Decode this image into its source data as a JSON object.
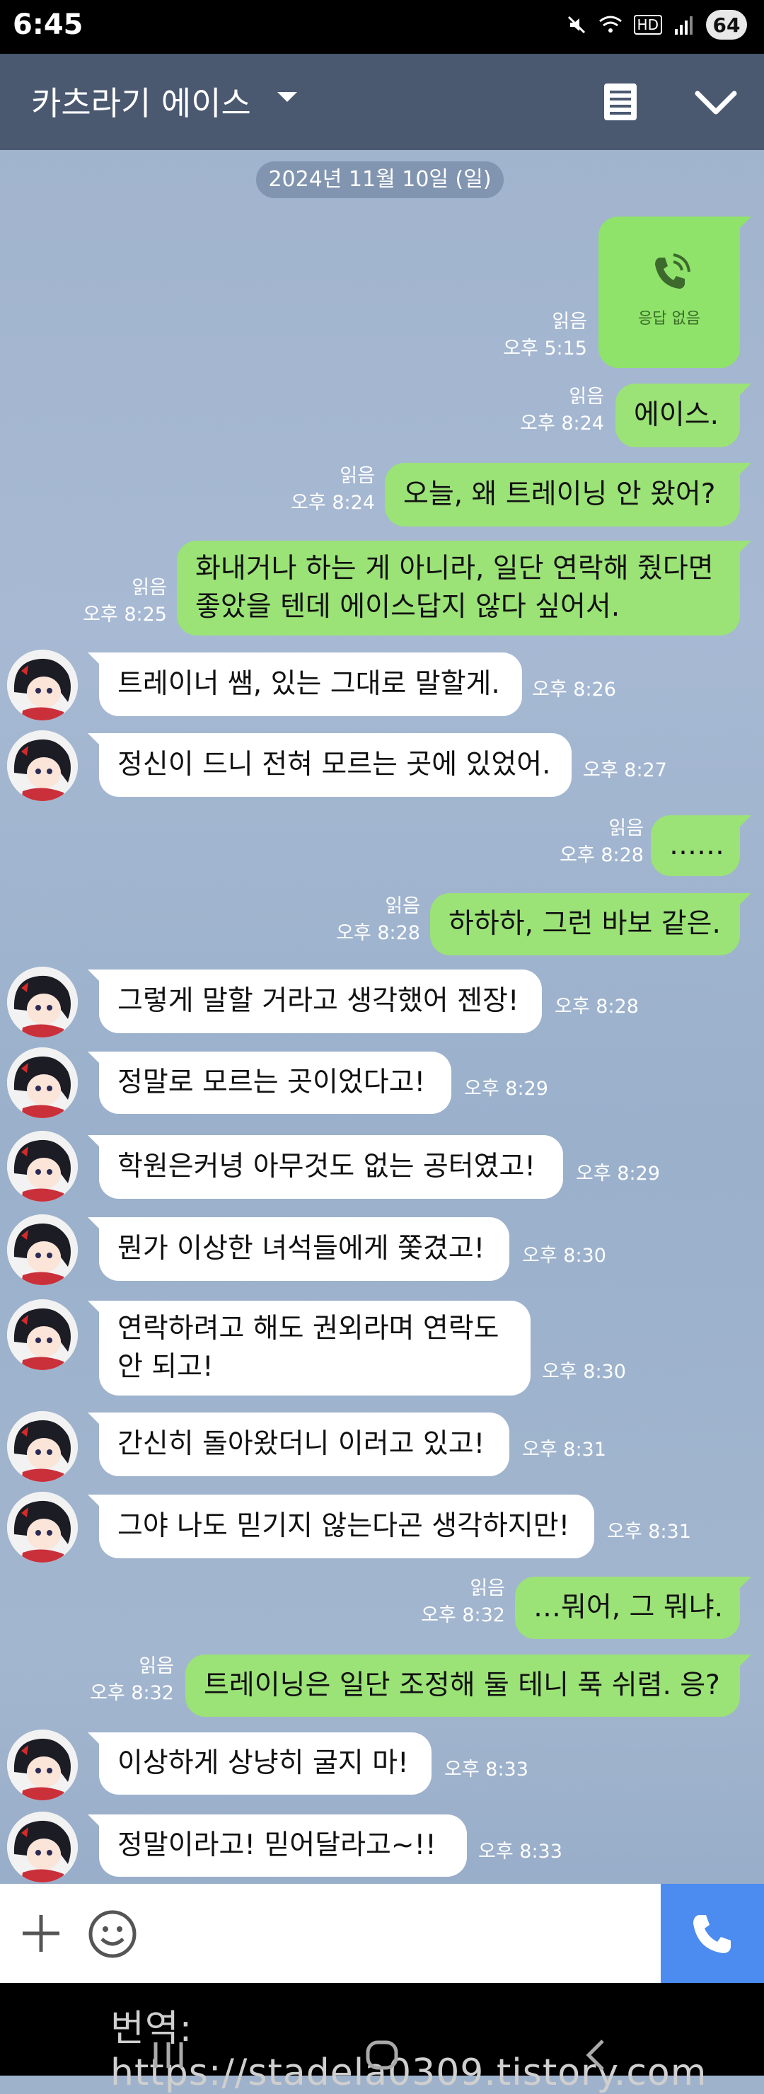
{
  "status_bar": {
    "time": "6:45",
    "battery": "64",
    "network": "HD"
  },
  "header": {
    "title": "카츠라기 에이스"
  },
  "date_divider": "2024년 11월 10일 (일)",
  "call": {
    "label": "응답 없음",
    "read": "읽음",
    "time": "오후 5:15"
  },
  "mine": [
    {
      "text": "에이스.",
      "read": "읽음",
      "time": "오후 8:24"
    },
    {
      "text": "오늘, 왜 트레이닝 안 왔어?",
      "read": "읽음",
      "time": "오후 8:24"
    },
    {
      "text": "화내거나 하는 게 아니라, 일단 연락해 줬다면 좋았을 텐데 에이스답지 않다 싶어서.",
      "read": "읽음",
      "time": "오후 8:25"
    },
    {
      "text": "……",
      "read": "읽음",
      "time": "오후 8:28"
    },
    {
      "text": "하하하, 그런 바보 같은.",
      "read": "읽음",
      "time": "오후 8:28"
    },
    {
      "text": "…뭐어, 그 뭐냐.",
      "read": "읽음",
      "time": "오후 8:32"
    },
    {
      "text": "트레이닝은 일단 조정해 둘 테니 푹 쉬렴. 응?",
      "read": "읽음",
      "time": "오후 8:32"
    }
  ],
  "theirs": [
    {
      "text": "트레이너 쌤, 있는 그대로 말할게.",
      "time": "오후 8:26"
    },
    {
      "text": "정신이 드니 전혀 모르는 곳에 있었어.",
      "time": "오후 8:27"
    },
    {
      "text": "그렇게 말할 거라고 생각했어 젠장!",
      "time": "오후 8:28"
    },
    {
      "text": "정말로 모르는 곳이었다고!",
      "time": "오후 8:29"
    },
    {
      "text": "학원은커녕 아무것도 없는 공터였고!",
      "time": "오후 8:29"
    },
    {
      "text": "뭔가 이상한 녀석들에게 쫓겼고!",
      "time": "오후 8:30"
    },
    {
      "text": "연락하려고 해도 권외라며 연락도 안 되고!",
      "time": "오후 8:30"
    },
    {
      "text": "간신히 돌아왔더니 이러고 있고!",
      "time": "오후 8:31"
    },
    {
      "text": "그야 나도 믿기지 않는다곤 생각하지만!",
      "time": "오후 8:31"
    },
    {
      "text": "이상하게 상냥히 굴지 마!",
      "time": "오후 8:33"
    },
    {
      "text": "정말이라고! 믿어달라고~!!",
      "time": "오후 8:33"
    }
  ],
  "watermark": "번역: https://stadela0309.tistory.com",
  "colors": {
    "header_bg": "#4a5870",
    "mine_bubble": "#9be277",
    "theirs_bubble": "#ffffff",
    "call_button": "#4c8bf0"
  }
}
